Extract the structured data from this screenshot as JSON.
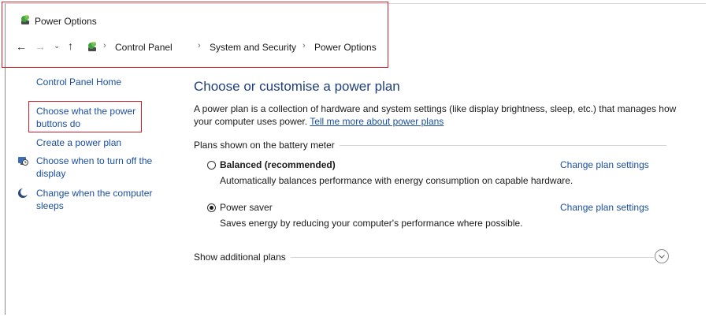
{
  "window": {
    "title": "Power Options"
  },
  "address_bar": {
    "crumbs": [
      "Control Panel",
      "System and Security",
      "Power Options"
    ],
    "separator": "›"
  },
  "nav": {
    "back": "←",
    "forward": "→",
    "recent": "⌄",
    "up": "↑"
  },
  "sidebar": {
    "home": "Control Panel Home",
    "power_buttons": "Choose what the power buttons do",
    "create_plan": "Create a power plan",
    "turn_off_display": "Choose when to turn off the display",
    "computer_sleeps": "Change when the computer sleeps"
  },
  "main": {
    "heading": "Choose or customise a power plan",
    "description": "A power plan is a collection of hardware and system settings (like display brightness, sleep, etc.) that manages how your computer uses power.",
    "description_link": "Tell me more about power plans",
    "plans_label": "Plans shown on the battery meter",
    "plans": [
      {
        "name": "Balanced (recommended)",
        "description": "Automatically balances performance with energy consumption on capable hardware.",
        "change_link": "Change plan settings",
        "selected": false
      },
      {
        "name": "Power saver",
        "description": "Saves energy by reducing your computer's performance where possible.",
        "change_link": "Change plan settings",
        "selected": true
      }
    ],
    "additional_plans": "Show additional plans",
    "expand_icon": "⌄"
  },
  "colors": {
    "link": "#1a4fa0",
    "heading": "#1e3f7a",
    "highlight": "#d0202b"
  },
  "icons": {
    "title": "power-options-icon",
    "address": "power-options-icon",
    "display": "monitor-clock-icon",
    "sleep": "moon-icon"
  }
}
